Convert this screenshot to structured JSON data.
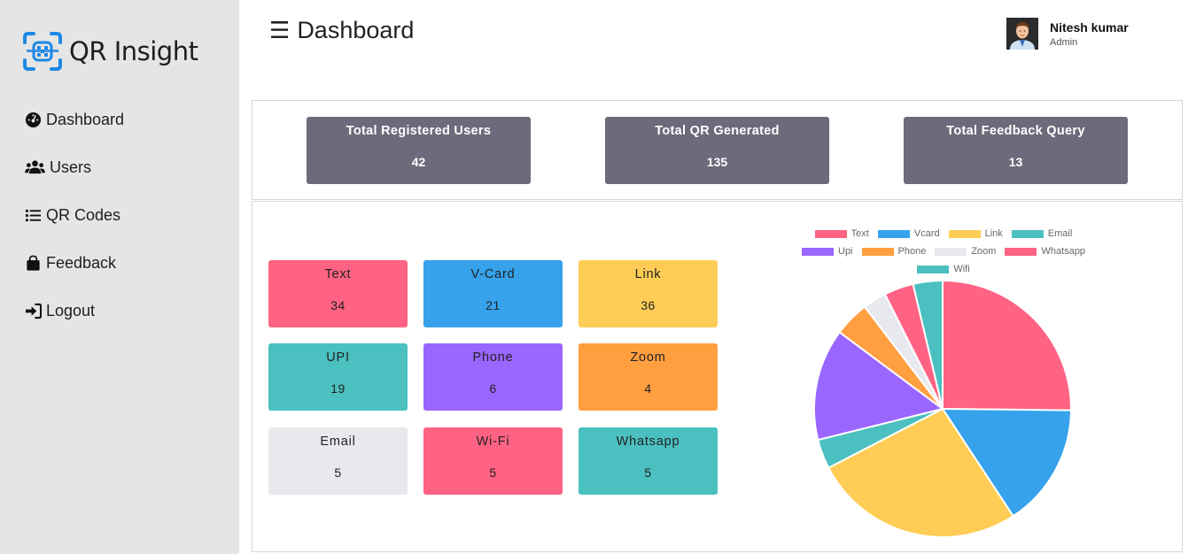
{
  "app": {
    "logo_text": "QR Insight"
  },
  "sidebar": {
    "items": [
      {
        "label": "Dashboard",
        "icon": "dashboard-gauge-icon"
      },
      {
        "label": "Users",
        "icon": "users-icon"
      },
      {
        "label": "QR Codes",
        "icon": "list-icon"
      },
      {
        "label": "Feedback",
        "icon": "shopping-bag-icon"
      },
      {
        "label": "Logout",
        "icon": "sign-in-arrow-icon"
      }
    ]
  },
  "header": {
    "title": "Dashboard",
    "menu_icon": "hamburger-icon",
    "user": {
      "name": "Nitesh kumar",
      "role": "Admin"
    }
  },
  "stats": [
    {
      "label": "Total Registered Users",
      "value": "42"
    },
    {
      "label": "Total QR Generated",
      "value": "135"
    },
    {
      "label": "Total Feedback Query",
      "value": "13"
    }
  ],
  "tiles": [
    {
      "label": "Text",
      "value": "34",
      "color": "#ff6384"
    },
    {
      "label": "V-Card",
      "value": "21",
      "color": "#36a2eb"
    },
    {
      "label": "Link",
      "value": "36",
      "color": "#ffcd56"
    },
    {
      "label": "UPI",
      "value": "19",
      "color": "#4bc0c0"
    },
    {
      "label": "Phone",
      "value": "6",
      "color": "#9966ff"
    },
    {
      "label": "Zoom",
      "value": "4",
      "color": "#ff9f40"
    },
    {
      "label": "Email",
      "value": "5",
      "color": "#e7e9ed"
    },
    {
      "label": "Wi-Fi",
      "value": "5",
      "color": "#ff6384"
    },
    {
      "label": "Whatsapp",
      "value": "5",
      "color": "#4bc0c0"
    }
  ],
  "chart_data": {
    "type": "pie",
    "legend_position": "top",
    "categories": [
      "Text",
      "Vcard",
      "Link",
      "Email",
      "Upi",
      "Phone",
      "Zoom",
      "Whatsapp",
      "Wifi"
    ],
    "values": [
      34,
      21,
      36,
      5,
      19,
      6,
      4,
      5,
      5
    ],
    "colors": [
      "#ff6384",
      "#36a2eb",
      "#ffcd56",
      "#4bc0c0",
      "#9966ff",
      "#ff9f40",
      "#e7e9ed",
      "#ff6384",
      "#4bc0c0"
    ]
  }
}
